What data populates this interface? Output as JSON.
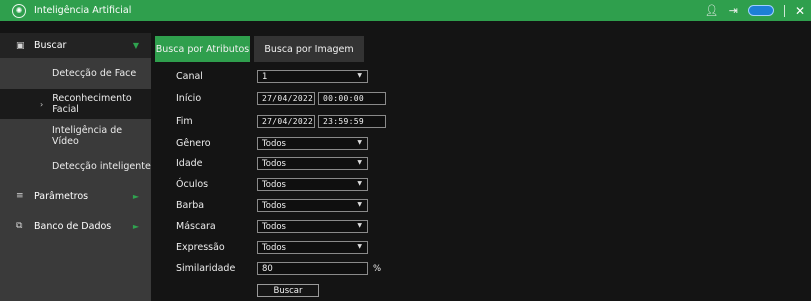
{
  "titlebar": {
    "title": "Inteligência Artificial"
  },
  "sidebar": {
    "buscar": {
      "label": "Buscar"
    },
    "submenu": [
      {
        "label": "Detecção de Face"
      },
      {
        "label": "Reconhecimento Facial"
      },
      {
        "label": "Inteligência de Vídeo"
      },
      {
        "label": "Detecção inteligente"
      }
    ],
    "parametros": {
      "label": "Parâmetros"
    },
    "banco": {
      "label": "Banco de Dados"
    }
  },
  "tabs": [
    {
      "label": "Busca por Atributos"
    },
    {
      "label": "Busca por Imagem"
    }
  ],
  "form": {
    "canal": {
      "label": "Canal",
      "value": "1"
    },
    "inicio": {
      "label": "Início",
      "date": "27/04/2022",
      "time": "00:00:00"
    },
    "fim": {
      "label": "Fim",
      "date": "27/04/2022",
      "time": "23:59:59"
    },
    "genero": {
      "label": "Gênero",
      "value": "Todos"
    },
    "idade": {
      "label": "Idade",
      "value": "Todos"
    },
    "oculos": {
      "label": "Óculos",
      "value": "Todos"
    },
    "barba": {
      "label": "Barba",
      "value": "Todos"
    },
    "mascara": {
      "label": "Máscara",
      "value": "Todos"
    },
    "expressao": {
      "label": "Expressão",
      "value": "Todos"
    },
    "similaridade": {
      "label": "Similaridade",
      "value": "80",
      "unit": "%"
    },
    "buscar_button": "Buscar"
  },
  "colors": {
    "accent": "#2f9f4d",
    "sidebar": "#3a3a3a",
    "background": "#141414"
  }
}
